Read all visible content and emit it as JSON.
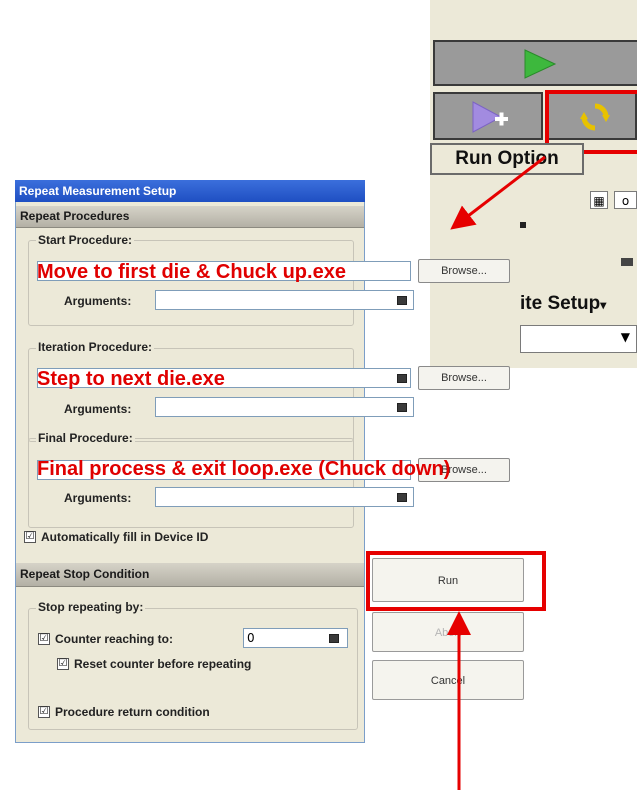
{
  "toolbar": {
    "run_option_label": "Run Option",
    "site_setup_label": "ite Setup",
    "mini_box_text": "o",
    "colors": {
      "play": "#3db83d",
      "add": "#a28be0",
      "repeat": "#e8c200"
    }
  },
  "dialog": {
    "title": "Repeat Measurement Setup",
    "repeat_procedures_header": "Repeat Procedures",
    "start": {
      "group_label": "Start Procedure:",
      "arguments_label": "Arguments:",
      "browse_label": "Browse...",
      "overlay_text": "Move to first die & Chuck up.exe"
    },
    "iteration": {
      "group_label": "Iteration Procedure:",
      "arguments_label": "Arguments:",
      "browse_label": "Browse...",
      "overlay_text": "Step to next die.exe"
    },
    "final": {
      "group_label": "Final Procedure:",
      "arguments_label": "Arguments:",
      "browse_label": "Browse...",
      "overlay_text": "Final process & exit loop.exe (Chuck down)"
    },
    "auto_fill_label": "Automatically fill in Device ID",
    "stop_condition_header": "Repeat Stop Condition",
    "stop_by_label": "Stop repeating by:",
    "counter_label": "Counter reaching to:",
    "counter_value": "0",
    "reset_counter_label": "Reset counter before repeating",
    "procedure_return_label": "Procedure return condition",
    "buttons": {
      "run": "Run",
      "abort": "Abort",
      "cancel": "Cancel"
    },
    "check_mark": "☑"
  },
  "annotation_color": "#e60000"
}
